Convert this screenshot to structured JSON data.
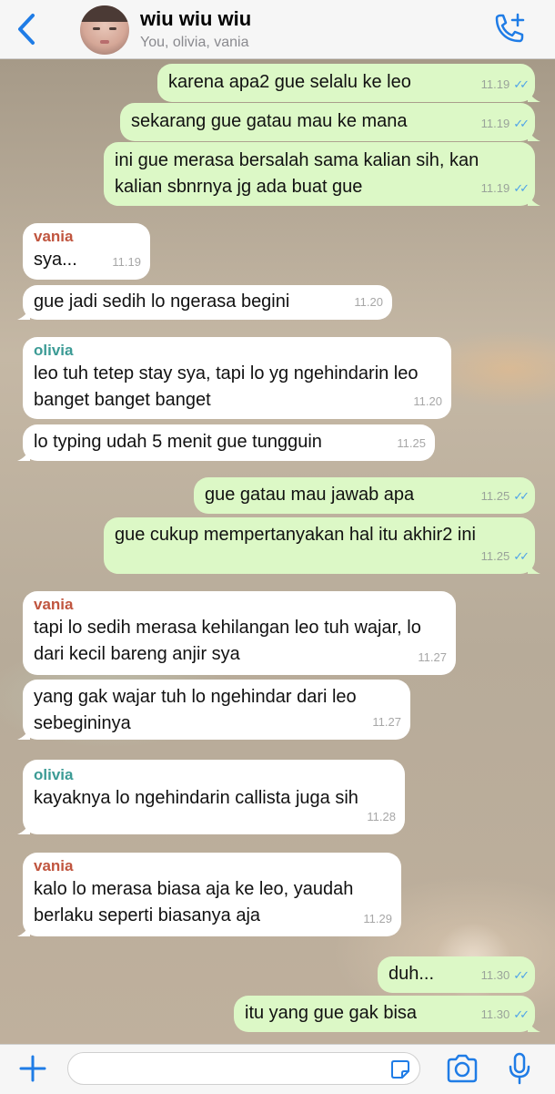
{
  "header": {
    "title": "wiu wiu wiu",
    "subtitle": "You, olivia, vania"
  },
  "messages": [
    {
      "dir": "out",
      "text": "karena apa2 gue selalu ke leo",
      "time": "11.19",
      "ticks": "✓✓"
    },
    {
      "dir": "out",
      "text": "sekarang gue gatau mau ke mana",
      "time": "11.19",
      "ticks": "✓✓"
    },
    {
      "dir": "out",
      "text": "ini gue merasa bersalah sama kalian sih, kan kalian sbnrnya jg ada buat gue",
      "time": "11.19",
      "ticks": "✓✓"
    },
    {
      "dir": "in",
      "sender": "vania",
      "text": "sya...",
      "time": "11.19"
    },
    {
      "dir": "in",
      "text": "gue jadi sedih lo ngerasa begini",
      "time": "11.20"
    },
    {
      "dir": "in",
      "sender": "olivia",
      "text": "leo tuh tetep stay sya, tapi lo yg ngehindarin leo banget banget banget",
      "time": "11.20"
    },
    {
      "dir": "in",
      "text": "lo typing udah 5 menit gue tungguin",
      "time": "11.25"
    },
    {
      "dir": "out",
      "text": "gue gatau mau jawab apa",
      "time": "11.25",
      "ticks": "✓✓"
    },
    {
      "dir": "out",
      "text": "gue cukup mempertanyakan hal itu akhir2 ini",
      "time": "11.25",
      "ticks": "✓✓"
    },
    {
      "dir": "in",
      "sender": "vania",
      "text": "tapi lo sedih merasa kehilangan leo tuh wajar, lo dari kecil bareng anjir sya",
      "time": "11.27"
    },
    {
      "dir": "in",
      "text": "yang gak wajar tuh lo ngehindar dari leo sebegininya",
      "time": "11.27"
    },
    {
      "dir": "in",
      "sender": "olivia",
      "text": "kayaknya lo ngehindarin callista juga sih",
      "time": "11.28"
    },
    {
      "dir": "in",
      "sender": "vania",
      "text": "kalo lo merasa biasa aja ke leo, yaudah berlaku seperti biasanya aja",
      "time": "11.29"
    },
    {
      "dir": "out",
      "text": "duh...",
      "time": "11.30",
      "ticks": "✓✓"
    },
    {
      "dir": "out",
      "text": "itu yang gue gak bisa",
      "time": "11.30",
      "ticks": "✓✓"
    }
  ],
  "composer": {
    "input_value": "",
    "input_placeholder": ""
  },
  "icons": {
    "back": "chevron-left-icon",
    "add_call": "phone-plus-icon",
    "attach": "plus-icon",
    "sticker": "sticker-icon",
    "camera": "camera-icon",
    "mic": "microphone-icon"
  },
  "colors": {
    "accent": "#1f7ce6",
    "outgoing_bubble": "#dcf8c6",
    "incoming_bubble": "#ffffff",
    "read_ticks": "#4fa3e8",
    "sender_vania": "#c0553f",
    "sender_olivia": "#3c9b95"
  }
}
